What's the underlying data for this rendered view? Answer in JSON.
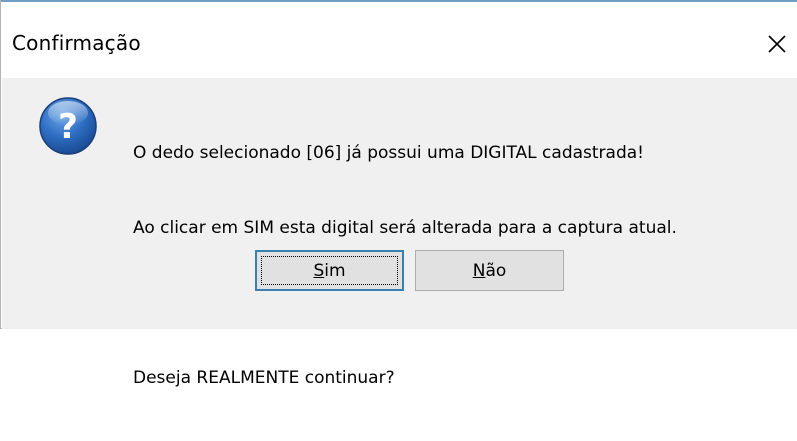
{
  "window": {
    "title": "Confirmação",
    "close_glyph": "✕"
  },
  "icon": {
    "name": "question-icon",
    "glyph": "?",
    "color": "#2a66b8"
  },
  "message": {
    "line1": "O dedo selecionado [06] já possui uma DIGITAL cadastrada!",
    "line2": "Ao clicar em SIM esta digital será alterada para a captura atual.",
    "line3": "Deseja REALMENTE continuar?"
  },
  "buttons": {
    "yes": {
      "mnemonic": "S",
      "rest": "im",
      "label": "Sim"
    },
    "no": {
      "mnemonic": "N",
      "rest": "ão",
      "label": "Não"
    }
  },
  "colors": {
    "dialog_bg": "#f0f0f0",
    "title_bg": "#ffffff",
    "button_bg": "#e1e1e1",
    "default_button_border": "#3c7fb1"
  }
}
